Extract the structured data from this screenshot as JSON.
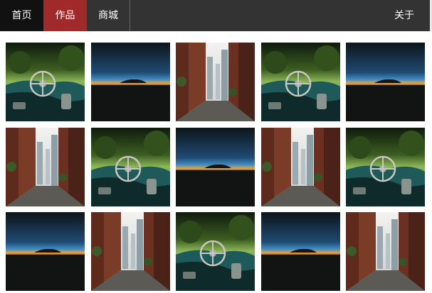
{
  "nav": {
    "home": "首页",
    "works": "作品",
    "shop": "商城",
    "about": "关于",
    "active": "works"
  },
  "gallery": {
    "rows": [
      [
        "car",
        "horizon",
        "alley",
        "car",
        "horizon"
      ],
      [
        "alley",
        "car",
        "horizon",
        "alley",
        "car"
      ],
      [
        "horizon",
        "alley",
        "car",
        "horizon",
        "alley"
      ]
    ]
  }
}
